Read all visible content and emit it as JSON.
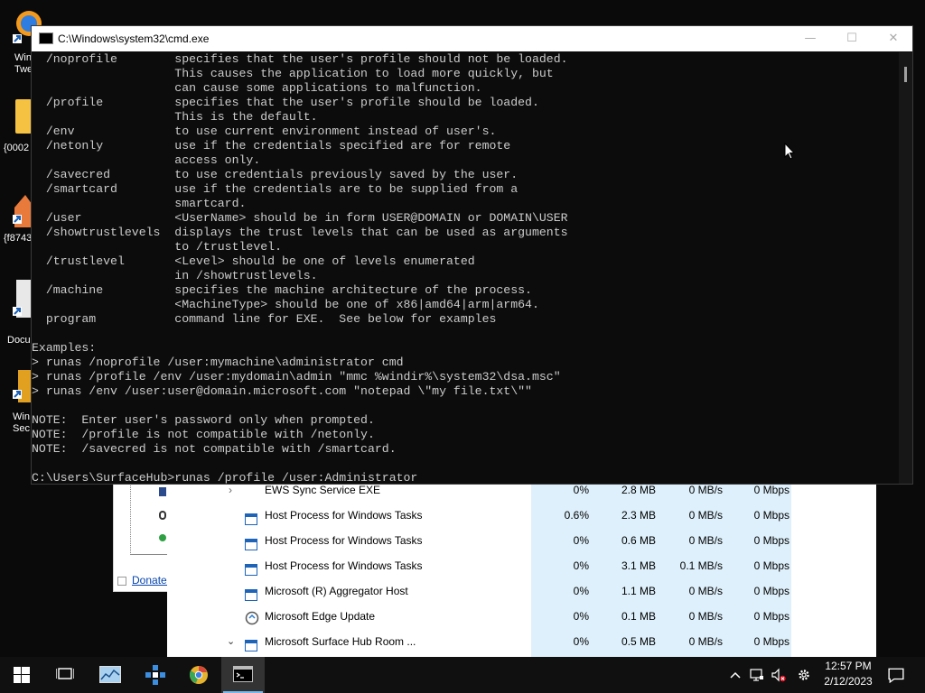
{
  "desktop": {
    "icons": [
      {
        "label": "Win\nTwe"
      },
      {
        "label": "{0002"
      },
      {
        "label": "{f8743"
      },
      {
        "label": "Docu"
      },
      {
        "label": "Win\nSec"
      }
    ]
  },
  "left_window": {
    "link_text": "Donate!"
  },
  "task_manager": {
    "rows": [
      {
        "name": "EWS Sync Service EXE",
        "cpu": "0%",
        "memory": "2.8 MB",
        "disk": "0 MB/s",
        "network": "0 Mbps",
        "icon": "expand-chevron-right-icon"
      },
      {
        "name": "Host Process for Windows Tasks",
        "cpu": "0.6%",
        "memory": "2.3 MB",
        "disk": "0 MB/s",
        "network": "0 Mbps",
        "icon": "window-app-icon"
      },
      {
        "name": "Host Process for Windows Tasks",
        "cpu": "0%",
        "memory": "0.6 MB",
        "disk": "0 MB/s",
        "network": "0 Mbps",
        "icon": "window-app-icon"
      },
      {
        "name": "Host Process for Windows Tasks",
        "cpu": "0%",
        "memory": "3.1 MB",
        "disk": "0.1 MB/s",
        "network": "0 Mbps",
        "icon": "window-app-icon"
      },
      {
        "name": "Microsoft (R) Aggregator Host",
        "cpu": "0%",
        "memory": "1.1 MB",
        "disk": "0 MB/s",
        "network": "0 Mbps",
        "icon": "window-app-icon"
      },
      {
        "name": "Microsoft Edge Update",
        "cpu": "0%",
        "memory": "0.1 MB",
        "disk": "0 MB/s",
        "network": "0 Mbps",
        "icon": "edge-update-icon"
      },
      {
        "name": "Microsoft Surface Hub Room ...",
        "cpu": "0%",
        "memory": "0.5 MB",
        "disk": "0 MB/s",
        "network": "0 Mbps",
        "icon": "window-app-icon"
      }
    ]
  },
  "cmd": {
    "title": "C:\\Windows\\system32\\cmd.exe",
    "minimize_label": "—",
    "maximize_label": "☐",
    "close_label": "✕",
    "lines": [
      "  /noprofile        specifies that the user's profile should not be loaded.",
      "                    This causes the application to load more quickly, but",
      "                    can cause some applications to malfunction.",
      "  /profile          specifies that the user's profile should be loaded.",
      "                    This is the default.",
      "  /env              to use current environment instead of user's.",
      "  /netonly          use if the credentials specified are for remote",
      "                    access only.",
      "  /savecred         to use credentials previously saved by the user.",
      "  /smartcard        use if the credentials are to be supplied from a",
      "                    smartcard.",
      "  /user             <UserName> should be in form USER@DOMAIN or DOMAIN\\USER",
      "  /showtrustlevels  displays the trust levels that can be used as arguments",
      "                    to /trustlevel.",
      "  /trustlevel       <Level> should be one of levels enumerated",
      "                    in /showtrustlevels.",
      "  /machine          specifies the machine architecture of the process.",
      "                    <MachineType> should be one of x86|amd64|arm|arm64.",
      "  program           command line for EXE.  See below for examples",
      "",
      "Examples:",
      "> runas /noprofile /user:mymachine\\administrator cmd",
      "> runas /profile /env /user:mydomain\\admin \"mmc %windir%\\system32\\dsa.msc\"",
      "> runas /env /user:user@domain.microsoft.com \"notepad \\\"my file.txt\\\"\"",
      "",
      "NOTE:  Enter user's password only when prompted.",
      "NOTE:  /profile is not compatible with /netonly.",
      "NOTE:  /savecred is not compatible with /smartcard.",
      "",
      "C:\\Users\\SurfaceHub>runas /profile /user:Administrator"
    ]
  },
  "taskbar": {
    "time": "12:57 PM",
    "date": "2/12/2023",
    "accent": "#76b9ed"
  }
}
